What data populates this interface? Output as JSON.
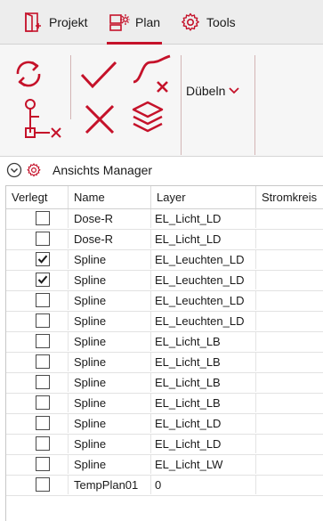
{
  "tabs": [
    {
      "label": "Projekt",
      "icon": "project-door-icon",
      "active": false
    },
    {
      "label": "Plan",
      "icon": "plan-layout-icon",
      "active": true
    },
    {
      "label": "Tools",
      "icon": "gear-icon",
      "active": false
    }
  ],
  "ribbon": {
    "dropdown_label": "Dübeln"
  },
  "manager": {
    "title": "Ansichts Manager"
  },
  "table": {
    "columns": [
      "Verlegt",
      "Name",
      "Layer",
      "Stromkreis"
    ],
    "rows": [
      {
        "verlegt": false,
        "name": "Dose-R",
        "layer": "EL_Licht_LD",
        "stromkreis": ""
      },
      {
        "verlegt": false,
        "name": "Dose-R",
        "layer": "EL_Licht_LD",
        "stromkreis": ""
      },
      {
        "verlegt": true,
        "name": "Spline",
        "layer": "EL_Leuchten_LD",
        "stromkreis": ""
      },
      {
        "verlegt": true,
        "name": "Spline",
        "layer": "EL_Leuchten_LD",
        "stromkreis": ""
      },
      {
        "verlegt": false,
        "name": "Spline",
        "layer": "EL_Leuchten_LD",
        "stromkreis": ""
      },
      {
        "verlegt": false,
        "name": "Spline",
        "layer": "EL_Leuchten_LD",
        "stromkreis": ""
      },
      {
        "verlegt": false,
        "name": "Spline",
        "layer": "EL_Licht_LB",
        "stromkreis": ""
      },
      {
        "verlegt": false,
        "name": "Spline",
        "layer": "EL_Licht_LB",
        "stromkreis": ""
      },
      {
        "verlegt": false,
        "name": "Spline",
        "layer": "EL_Licht_LB",
        "stromkreis": ""
      },
      {
        "verlegt": false,
        "name": "Spline",
        "layer": "EL_Licht_LB",
        "stromkreis": ""
      },
      {
        "verlegt": false,
        "name": "Spline",
        "layer": "EL_Licht_LD",
        "stromkreis": ""
      },
      {
        "verlegt": false,
        "name": "Spline",
        "layer": "EL_Licht_LD",
        "stromkreis": ""
      },
      {
        "verlegt": false,
        "name": "Spline",
        "layer": "EL_Licht_LW",
        "stromkreis": ""
      },
      {
        "verlegt": false,
        "name": "TempPlan01",
        "layer": "0",
        "stromkreis": ""
      }
    ]
  },
  "colors": {
    "accent": "#c5122a",
    "tab_bar": "#ededed",
    "ribbon": "#f6f6f6"
  }
}
